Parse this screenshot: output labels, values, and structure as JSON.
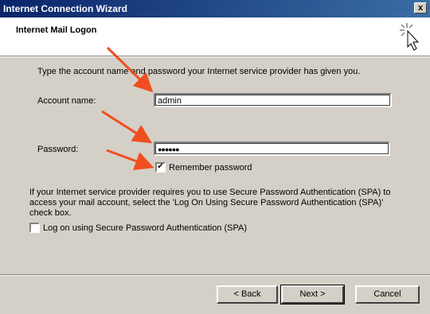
{
  "window": {
    "title": "Internet Connection Wizard",
    "close_label": "x"
  },
  "header": {
    "title": "Internet Mail Logon",
    "icon": "wizard-cursor-icon"
  },
  "instructions": "Type the account name and password your Internet service provider has given you.",
  "account": {
    "label": "Account name:",
    "value": "admin"
  },
  "password": {
    "label": "Password:",
    "value": "●●●●●●"
  },
  "remember": {
    "label": "Remember password",
    "checked": true,
    "mark": "✔"
  },
  "spa": {
    "description_line1": "If your Internet service provider requires you to use Secure Password Authentication (SPA) to",
    "description_line2": "access your mail account, select the 'Log On Using Secure Password Authentication (SPA)'",
    "description_line3": "check box.",
    "checkbox_label": "Log on using Secure Password Authentication (SPA)",
    "checked": false
  },
  "buttons": {
    "back": "< Back",
    "next": "Next >",
    "cancel": "Cancel"
  },
  "colors": {
    "arrow": "#f04e1e",
    "dialog_bg": "#d4d0c8",
    "title_bar": "#0a246a"
  }
}
